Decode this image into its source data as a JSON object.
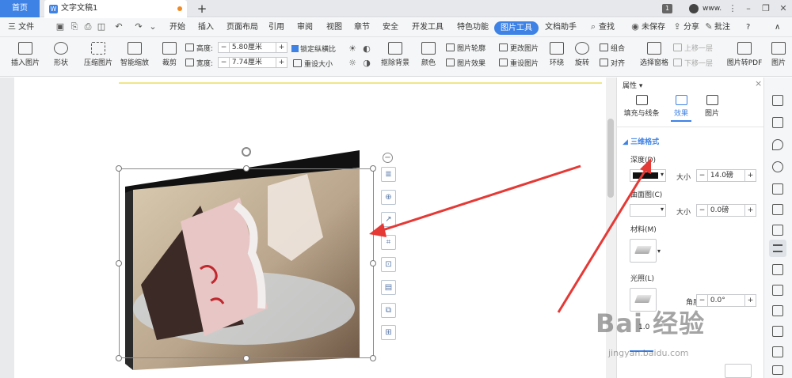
{
  "tabs": {
    "home": "首页",
    "doc": "文字文稿1",
    "new_tab": "+"
  },
  "window": {
    "badge": "1",
    "user": "www.",
    "minimize": "–",
    "restore": "❐",
    "close": "✕",
    "overflow": "⋮"
  },
  "menu": {
    "file": "三 文件",
    "items": [
      "开始",
      "插入",
      "页面布局",
      "引用",
      "审阅",
      "视图",
      "章节",
      "安全",
      "开发工具",
      "特色功能"
    ],
    "active": "图片工具",
    "after": [
      "文档助手"
    ],
    "search": "查找",
    "unsaved": "未保存",
    "share": "分享",
    "annotate": "批注",
    "help": "?",
    "collapse": "∧"
  },
  "ribbon": {
    "insert_pic": "插入图片",
    "shape": "形状",
    "compress": "压缩图片",
    "smart_zoom": "智能缩放",
    "crop": "裁剪",
    "height_label": "高度:",
    "height_value": "5.80厘米",
    "width_label": "宽度:",
    "width_value": "7.74厘米",
    "lock_ratio": "锁定纵横比",
    "reset_size": "重设大小",
    "remove_bg": "抠除背景",
    "color": "颜色",
    "pic_outline": "图片轮廓",
    "pic_effect": "图片效果",
    "change_pic": "更改图片",
    "reset_pic": "重设图片",
    "wrap": "环绕",
    "rotate": "旋转",
    "group": "组合",
    "align": "对齐",
    "select_pane": "选择窗格",
    "bring_forward": "上移一层",
    "send_backward": "下移一层",
    "pic_to_pdf": "图片转PDF",
    "pic_more": "图片"
  },
  "panel": {
    "title": "属性",
    "close": "×",
    "tab_fill": "填充与线条",
    "tab_effect": "效果",
    "tab_pic": "图片",
    "section": "三维格式",
    "depth_label": "深度(D)",
    "size_label": "大小",
    "depth_size": "14.0磅",
    "contour_label": "曲面图(C)",
    "contour_size": "0.0磅",
    "material_label": "材料(M)",
    "lighting_label": "光照(L)",
    "angle_label": "角度",
    "angle_value": "0.0°",
    "extra_value": "1.0",
    "colors": {
      "depth_swatch": "#111111",
      "accent": "#3e82e5"
    }
  },
  "float_tools": {
    "collapse": "−"
  },
  "watermark": {
    "logo": "Bai 经验",
    "url": "jingyan.baidu.com"
  }
}
